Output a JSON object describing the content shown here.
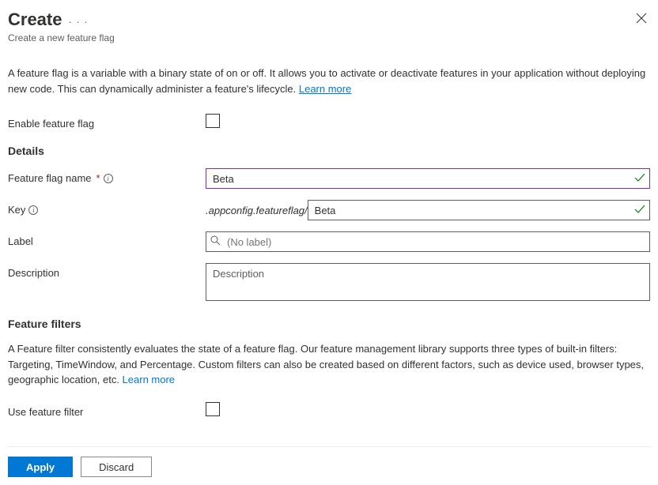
{
  "header": {
    "title": "Create",
    "subtitle": "Create a new feature flag"
  },
  "intro": {
    "text": "A feature flag is a variable with a binary state of on or off. It allows you to activate or deactivate features in your application without deploying new code. This can dynamically administer a feature's lifecycle. ",
    "learnMore": "Learn more"
  },
  "enable": {
    "label": "Enable feature flag"
  },
  "details": {
    "heading": "Details",
    "name": {
      "label": "Feature flag name",
      "value": "Beta"
    },
    "key": {
      "label": "Key",
      "prefix": ".appconfig.featureflag/",
      "value": "Beta"
    },
    "labelField": {
      "label": "Label",
      "placeholder": "(No label)"
    },
    "description": {
      "label": "Description",
      "placeholder": "Description"
    }
  },
  "filters": {
    "heading": "Feature filters",
    "text": "A Feature filter consistently evaluates the state of a feature flag. Our feature management library supports three types of built-in filters: Targeting, TimeWindow, and Percentage. Custom filters can also be created based on different factors, such as device used, browser types, geographic location, etc. ",
    "learnMore": "Learn more",
    "useLabel": "Use feature filter"
  },
  "footer": {
    "apply": "Apply",
    "discard": "Discard"
  }
}
